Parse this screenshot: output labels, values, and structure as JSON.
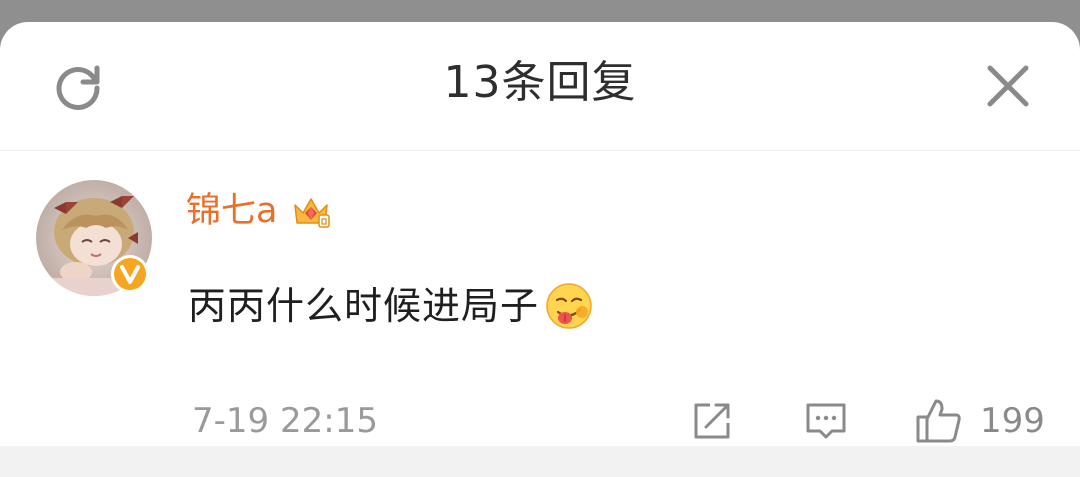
{
  "header": {
    "title": "13条回复",
    "refresh_icon": "refresh-icon",
    "close_icon": "close-icon"
  },
  "comment": {
    "username": "锦七a",
    "badge_icon": "crown-gem-icon",
    "verified_icon": "verified-v-icon",
    "text": "丙丙什么时候进局子",
    "emoji": "tongue-emoji-icon",
    "time": "7-19 22:15",
    "like_count": "199",
    "share_icon": "share-icon",
    "reply_icon": "comment-icon",
    "like_icon": "thumbs-up-icon"
  },
  "colors": {
    "username": "#e8702a",
    "verified": "#f5a623",
    "text": "#1f1f1f",
    "meta": "#9a9a9a",
    "backdrop": "#8f8f8f"
  }
}
